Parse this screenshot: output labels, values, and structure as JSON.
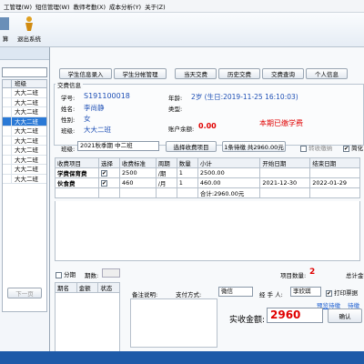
{
  "menu": [
    "工管理(W)",
    "短信管理(W)",
    "教师考勤(X)",
    "成本分析(Y)",
    "关于(Z)"
  ],
  "toolbar": {
    "left_label": "算",
    "exit_label": "退出系统"
  },
  "left_panel": {
    "col_header": "班级",
    "prev_btn": "下一页",
    "classes": [
      "大大二班",
      "大大二班",
      "大大二班",
      "大大二班",
      "大大二班",
      "大大二班",
      "大大二班",
      "大大二班",
      "大大二班",
      "大大二班"
    ],
    "selected_index": 3
  },
  "actions": {
    "enroll": "学生信息录入",
    "account": "学生分帐管理",
    "today": "当天交费",
    "history": "历史交费",
    "query": "交费查询",
    "personal": "个人信息"
  },
  "student": {
    "section": "交费信息",
    "id_label": "学号:",
    "id": "S191100018",
    "age_label": "年龄:",
    "age": "2岁 (生日:2019-11-25 16:10:03)",
    "name_label": "姓名:",
    "name": "李尚静",
    "type_label": "类型:",
    "gender_label": "性别:",
    "gender": "女",
    "balance_label": "账户余额:",
    "balance": "0.00",
    "class_label": "班级:",
    "class": "大大二班",
    "period_status": "本期已缴学费"
  },
  "filter": {
    "class_label": "班级:",
    "class_value": "2021秋季期 中二班",
    "select_btn": "选择收费项目",
    "pending_btn": "1条待缴 共2960.00元",
    "cb1": "转收缴纳",
    "cb2": "简化"
  },
  "fees": {
    "headers": [
      "收费项目",
      "选择",
      "收费标准",
      "周期",
      "数量",
      "小计",
      "开始日期",
      "结束日期"
    ],
    "rows": [
      [
        "学费保育费",
        "",
        "2500",
        "/期",
        "1",
        "2500.00",
        "",
        ""
      ],
      [
        "伙食费",
        "",
        "460",
        "/月",
        "1",
        "460.00",
        "2021-12-30",
        "2022-01-29"
      ]
    ],
    "total": "合计:2960.00元"
  },
  "bottom": {
    "split_label": "分期",
    "period_label": "期数:",
    "items_label": "项目数量:",
    "items_count": "2",
    "total_label": "总计金额",
    "sub_headers": [
      "期名",
      "金额",
      "状态"
    ],
    "remark_label": "备注说明:",
    "paymethod_label": "支付方式:",
    "paymethod": "微信",
    "handler_label": "经 手 人:",
    "handler": "李欣琪",
    "print_label": "打印票据",
    "link1": "预览待缴",
    "link2": "待缴",
    "amount_label": "实收金额:",
    "amount": "2960",
    "confirm": "确认"
  }
}
